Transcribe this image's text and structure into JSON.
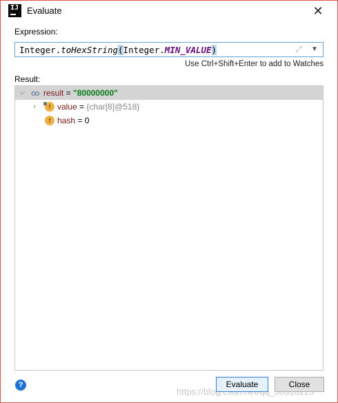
{
  "dialog": {
    "title": "Evaluate",
    "app_icon_text": "IJ"
  },
  "expression": {
    "label": "Expression:",
    "parts": {
      "cls1": "Integer.",
      "method": "toHexString",
      "open": "(",
      "cls2": "Integer.",
      "constant": "MIN_VALUE",
      "close": ")"
    },
    "hint": "Use Ctrl+Shift+Enter to add to Watches"
  },
  "result": {
    "label": "Result:",
    "tree": [
      {
        "name": "result",
        "eq": " = ",
        "value": "\"80000000\""
      },
      {
        "name": "value",
        "eq": " = ",
        "value": "{char[8]@518}"
      },
      {
        "name": "hash",
        "eq": " = ",
        "value": "0"
      }
    ]
  },
  "buttons": {
    "evaluate": "Evaluate",
    "close": "Close",
    "help": "?"
  },
  "watermark": "https://blog.csdn.net/qq_30310223",
  "colors": {
    "accent": "#3d7bd9",
    "string_value": "#067d17",
    "field_name": "#7a1a1a",
    "dialog_border": "#d9534f"
  },
  "icons": [
    "app-logo-icon",
    "close-icon",
    "expand-icon",
    "dropdown-icon",
    "watch-glasses-icon",
    "field-icon",
    "chevron-icon",
    "help-icon"
  ]
}
